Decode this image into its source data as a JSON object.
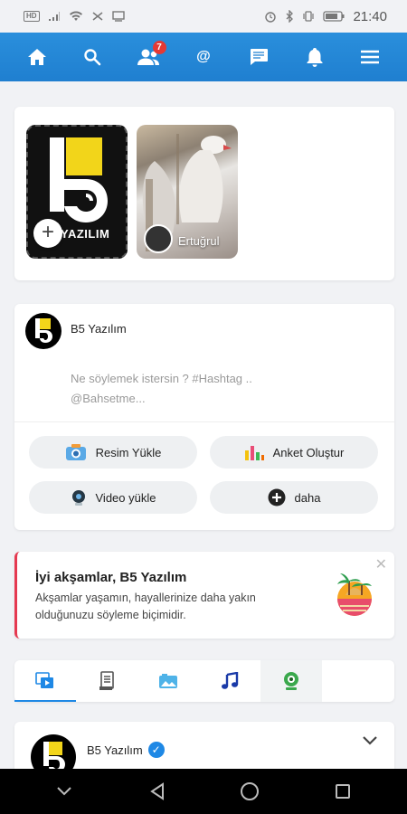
{
  "status_bar": {
    "left_badge": "HD",
    "time": "21:40",
    "battery_level": "80"
  },
  "topnav": {
    "friend_requests_count": "7",
    "mention_symbol": "@"
  },
  "stories": {
    "add_logo_text": "YAZILIM",
    "add_symbol": "+",
    "user_story_name": "Ertuğrul"
  },
  "composer": {
    "author_name": "B5 Yazılım",
    "placeholder": "Ne söylemek istersin ? #Hashtag .. @Bahsetme...",
    "actions": {
      "upload_image": "Resim Yükle",
      "create_poll": "Anket Oluştur",
      "upload_video": "Video yükle",
      "more": "daha"
    }
  },
  "greeting": {
    "title": "İyi akşamlar, B5 Yazılım",
    "body": "Akşamlar yaşamın, hayallerinize daha yakın olduğunuzu söyleme biçimidir.",
    "close_symbol": "✕"
  },
  "post": {
    "author_name": "B5 Yazılım"
  },
  "colors": {
    "nav_blue": "#1f7fd0",
    "badge_red": "#e53935",
    "accent_red": "#e53950",
    "verified_blue": "#1e88e5"
  },
  "icons": {
    "topnav": [
      "home-icon",
      "search-icon",
      "friends-icon",
      "mention-icon",
      "messages-icon",
      "notifications-icon",
      "menu-icon"
    ],
    "tabs": [
      "media-icon",
      "document-icon",
      "photo-icon",
      "music-icon",
      "webcam-icon"
    ],
    "bottomnav": [
      "chevron-down-icon",
      "back-icon",
      "home-circle-icon",
      "recents-icon"
    ]
  }
}
